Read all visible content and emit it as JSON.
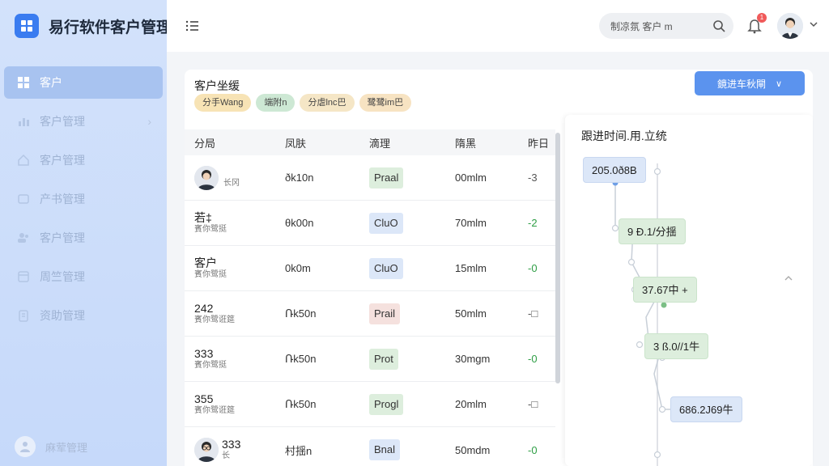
{
  "brand": {
    "title": "易行软件客户管理"
  },
  "sidebar": {
    "items": [
      {
        "label": "客户",
        "icon": "grid-icon",
        "active": true
      },
      {
        "label": "客户管理",
        "icon": "chart-icon",
        "has_submenu": true
      },
      {
        "label": "客户管理",
        "icon": "home-icon"
      },
      {
        "label": "产书管理",
        "icon": "card-icon"
      },
      {
        "label": "客户管理",
        "icon": "users-icon"
      },
      {
        "label": "周竺管理",
        "icon": "window-icon"
      },
      {
        "label": "资助管理",
        "icon": "clipboard-icon"
      }
    ],
    "user_label": "麻荤管理"
  },
  "header": {
    "search_text": "制凉氛 客户 m",
    "notification_count": "1"
  },
  "card": {
    "title": "客户坐缓",
    "tags": [
      "分手Wang",
      "端附n",
      "分虐lnc巴",
      "鹭鹭im巴"
    ],
    "action_button": "鏡进车秋閘"
  },
  "table": {
    "headers": [
      "分局",
      "凤肤",
      "滴理",
      "隋黑",
      "昨日"
    ],
    "rows": [
      {
        "name": "长冈",
        "sub": "",
        "has_avatar": true,
        "col2": "ðk10n",
        "status": "Prаal",
        "status_color": "#ddeedd",
        "col4": "00mlm",
        "trend": "-3",
        "trend_type": "flat"
      },
      {
        "name": "若‡",
        "sub": "賓你鹭挺",
        "has_avatar": false,
        "col2": "θk00n",
        "status": "CluO",
        "status_color": "#dce7f8",
        "col4": "70mlm",
        "trend": "-2",
        "trend_type": "up"
      },
      {
        "name": "客户",
        "sub": "賓你鹭挺",
        "has_avatar": false,
        "col2": "0k0m",
        "status": "CluO",
        "status_color": "#dce7f8",
        "col4": "15mlm",
        "trend": "-0",
        "trend_type": "up"
      },
      {
        "name": "242",
        "sub": "賓你鹭诳筵",
        "has_avatar": false,
        "col2": "Ռk50n",
        "status": "Prаil",
        "status_color": "#f5e1de",
        "col4": "50mlm",
        "trend": "-□",
        "trend_type": "flat"
      },
      {
        "name": "333",
        "sub": "賓你鹭挺",
        "has_avatar": false,
        "col2": "Ռk50n",
        "status": "Prot",
        "status_color": "#ddeedd",
        "col4": "30mgm",
        "trend": "-0",
        "trend_type": "up"
      },
      {
        "name": "355",
        "sub": "賓你鹭诳筵",
        "has_avatar": false,
        "col2": "Ռk50n",
        "status": "Progl",
        "status_color": "#ddeedd",
        "col4": "20mlm",
        "trend": "-□",
        "trend_type": "flat"
      },
      {
        "name": "333",
        "sub": "长",
        "has_avatar": true,
        "col2": "村揺n",
        "status": "Bnal",
        "status_color": "#dce7f8",
        "col4": "50mdm",
        "trend": "-0",
        "trend_type": "up"
      }
    ]
  },
  "timeline": {
    "title": "跟进时间.用.立统",
    "nodes": [
      {
        "label": "205.0ð8B",
        "style": "blue"
      },
      {
        "label": "9 Ð.1/分揺",
        "style": "green"
      },
      {
        "label": "37.67中 +",
        "style": "green"
      },
      {
        "label": "3 ß.0//1牛",
        "style": "green"
      },
      {
        "label": "686.2J69牛",
        "style": "blue"
      }
    ]
  },
  "colors": {
    "accent": "#5b93ee",
    "sidebar_bg": "#c6d9fa",
    "tag_colors": [
      "#f7e3b5",
      "#cde8d4",
      "#f5e6c6",
      "#f7e3c2"
    ]
  }
}
